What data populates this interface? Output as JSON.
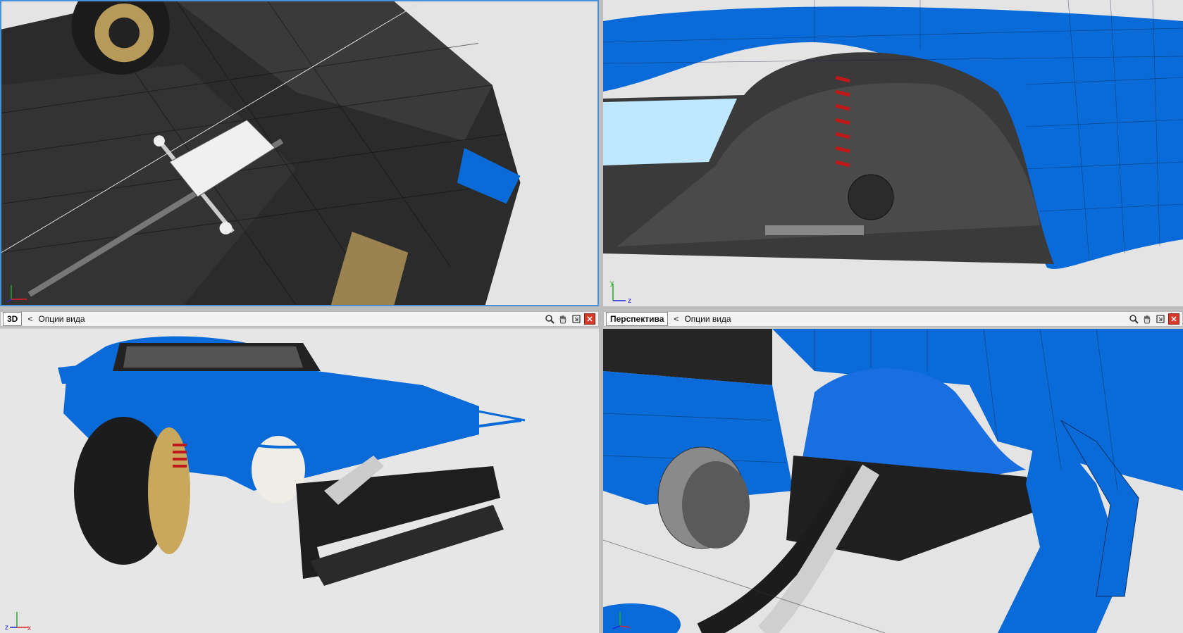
{
  "viewports": {
    "top_left": {
      "label": "top-left-viewport"
    },
    "top_right": {
      "label": "top-right-viewport"
    },
    "bottom_left": {
      "mode": "3D",
      "options": "Опции вида"
    },
    "bottom_right": {
      "mode": "Перспектива",
      "options": "Опции вида"
    }
  },
  "axes": {
    "x": "x",
    "y": "y",
    "z": "z"
  },
  "icons": {
    "zoom": "magnifier-icon",
    "pan": "hand-icon",
    "maximize": "maximize-icon",
    "close": "close-icon"
  },
  "colors": {
    "accent": "#0a6bd8",
    "mesh_dark": "#2a2a2a",
    "viewport_bg": "#e4e4e4",
    "active_border": "#4a90d9"
  }
}
